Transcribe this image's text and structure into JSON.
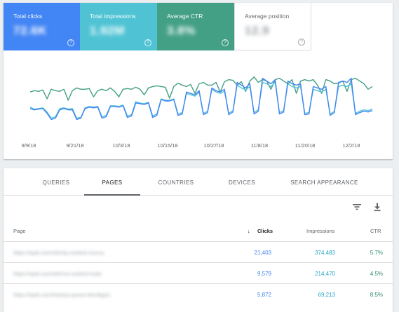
{
  "metrics": {
    "clicks": {
      "label": "Total clicks",
      "value": "72.6K"
    },
    "impressions": {
      "label": "Total impressions",
      "value": "1.92M"
    },
    "ctr": {
      "label": "Average CTR",
      "value": "3.8%"
    },
    "position": {
      "label": "Average position",
      "value": "12.9"
    },
    "help_glyph": "?"
  },
  "chart": {
    "x_ticks": [
      "9/9/18",
      "9/21/18",
      "10/3/18",
      "10/15/18",
      "10/27/18",
      "11/8/18",
      "11/20/18",
      "12/2/18"
    ],
    "colors": {
      "clicks": "#4285f4",
      "impressions": "#4fc3d4",
      "ctr": "#43a085"
    }
  },
  "chart_data": {
    "type": "line",
    "x": [
      "9/9/18",
      "9/21/18",
      "10/3/18",
      "10/15/18",
      "10/27/18",
      "11/8/18",
      "11/20/18",
      "12/2/18"
    ],
    "series": [
      {
        "color": "#43a085",
        "values": [
          0.62,
          0.64,
          0.63,
          0.65,
          0.52,
          0.66,
          0.64,
          0.63,
          0.66,
          0.5,
          0.64,
          0.68,
          0.66,
          0.66,
          0.67,
          0.55,
          0.64,
          0.66,
          0.64,
          0.68,
          0.63,
          0.55,
          0.66,
          0.67,
          0.66,
          0.69,
          0.66,
          0.58,
          0.68,
          0.7,
          0.71,
          0.7,
          0.69,
          0.53,
          0.7,
          0.75,
          0.72,
          0.7,
          0.73,
          0.6,
          0.74,
          0.76,
          0.72,
          0.72,
          0.76,
          0.62,
          0.77,
          0.8,
          0.79,
          0.72,
          0.77,
          0.63,
          0.78,
          0.84,
          0.76,
          0.8,
          0.78,
          0.66,
          0.8,
          0.82,
          0.78,
          0.74,
          0.8,
          0.6,
          0.78,
          0.8,
          0.78,
          0.8,
          0.72,
          0.6,
          0.8,
          0.78,
          0.74,
          0.75,
          0.78,
          0.63,
          0.8,
          0.82,
          0.78,
          0.74,
          0.66,
          0.7
        ]
      },
      {
        "color": "#4fc3d4",
        "values": [
          0.4,
          0.37,
          0.38,
          0.39,
          0.33,
          0.24,
          0.26,
          0.38,
          0.39,
          0.37,
          0.38,
          0.24,
          0.25,
          0.39,
          0.41,
          0.4,
          0.41,
          0.26,
          0.28,
          0.42,
          0.42,
          0.41,
          0.43,
          0.27,
          0.29,
          0.48,
          0.46,
          0.45,
          0.47,
          0.27,
          0.3,
          0.52,
          0.5,
          0.5,
          0.52,
          0.3,
          0.32,
          0.6,
          0.58,
          0.56,
          0.62,
          0.31,
          0.34,
          0.66,
          0.62,
          0.6,
          0.63,
          0.31,
          0.35,
          0.72,
          0.68,
          0.65,
          0.7,
          0.32,
          0.36,
          0.76,
          0.74,
          0.7,
          0.76,
          0.32,
          0.35,
          0.74,
          0.7,
          0.68,
          0.7,
          0.31,
          0.32,
          0.66,
          0.64,
          0.62,
          0.66,
          0.3,
          0.34,
          0.7,
          0.72,
          0.7,
          0.74,
          0.31,
          0.34,
          0.36,
          0.35,
          0.37
        ]
      },
      {
        "color": "#4285f4",
        "values": [
          0.38,
          0.36,
          0.37,
          0.38,
          0.31,
          0.22,
          0.24,
          0.36,
          0.38,
          0.36,
          0.36,
          0.22,
          0.24,
          0.38,
          0.4,
          0.39,
          0.4,
          0.24,
          0.26,
          0.41,
          0.41,
          0.4,
          0.42,
          0.25,
          0.27,
          0.46,
          0.45,
          0.44,
          0.46,
          0.25,
          0.28,
          0.51,
          0.49,
          0.49,
          0.51,
          0.28,
          0.3,
          0.62,
          0.6,
          0.58,
          0.64,
          0.29,
          0.32,
          0.68,
          0.64,
          0.62,
          0.66,
          0.29,
          0.33,
          0.76,
          0.72,
          0.68,
          0.74,
          0.3,
          0.34,
          0.82,
          0.78,
          0.74,
          0.8,
          0.3,
          0.33,
          0.78,
          0.74,
          0.72,
          0.74,
          0.29,
          0.3,
          0.7,
          0.68,
          0.66,
          0.7,
          0.28,
          0.32,
          0.76,
          0.78,
          0.76,
          0.82,
          0.29,
          0.32,
          0.34,
          0.33,
          0.35
        ]
      }
    ]
  },
  "tabs": [
    "QUERIES",
    "PAGES",
    "COUNTRIES",
    "DEVICES",
    "SEARCH APPEARANCE"
  ],
  "table": {
    "headers": {
      "page": "Page",
      "clicks": "Clicks",
      "sort_glyph": "↓",
      "impressions": "Impressions",
      "ctr": "CTR"
    },
    "rows": [
      {
        "page": "https://opdr.com/nl/d-kp-ourliest-muncy",
        "clicks": "21,403",
        "impressions": "374,483",
        "ctr": "5.7%"
      },
      {
        "page": "https://opdr.com/nl/d-hui-ourliest-hudo",
        "clicks": "9,579",
        "impressions": "214,470",
        "ctr": "4.5%"
      },
      {
        "page": "https://opdr.com/hisdorp-queue-tkeulbgen",
        "clicks": "5,872",
        "impressions": "69,213",
        "ctr": "8.5%"
      }
    ]
  }
}
